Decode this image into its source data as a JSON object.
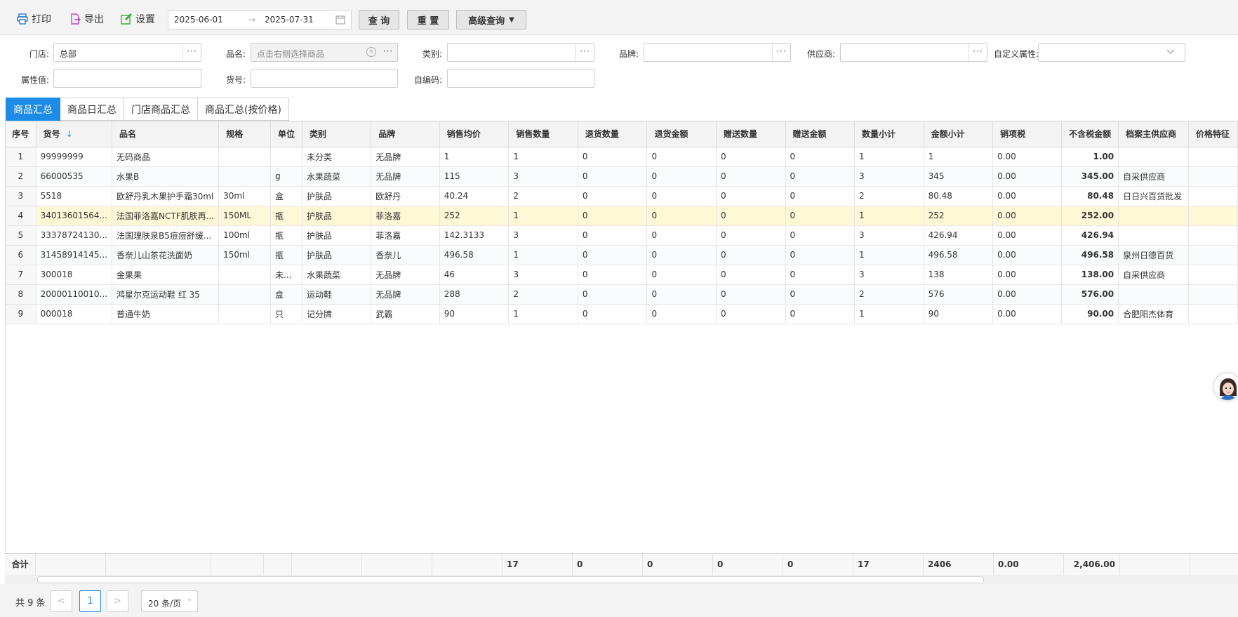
{
  "toolbar": {
    "print_label": "打印",
    "export_label": "导出",
    "settings_label": "设置",
    "date_start": "2025-06-01",
    "date_sep": "→",
    "date_end": "2025-07-31",
    "query_label": "查 询",
    "reset_label": "重 置",
    "advanced_label": "高级查询"
  },
  "filters": {
    "store_label": "门店:",
    "store_value": "总部",
    "product_label": "品名:",
    "product_placeholder": "点击右侧选择商品",
    "category_label": "类别:",
    "brand_label": "品牌:",
    "supplier_label": "供应商:",
    "custom_attr_label": "自定义属性:",
    "attr_value_label": "属性值:",
    "sku_label": "货号:",
    "selfcode_label": "自编码:",
    "dots": "···"
  },
  "tabs": [
    "商品汇总",
    "商品日汇总",
    "门店商品汇总",
    "商品汇总(按价格)"
  ],
  "table": {
    "headers": [
      "序号",
      "货号",
      "品名",
      "规格",
      "单位",
      "类别",
      "品牌",
      "销售均价",
      "销售数量",
      "退货数量",
      "退货金额",
      "赠送数量",
      "赠送金额",
      "数量小计",
      "金额小计",
      "销项税",
      "不含税金额",
      "档案主供应商",
      "价格特征"
    ],
    "sort_icon": "↓",
    "rows": [
      [
        "1",
        "99999999",
        "无码商品",
        "",
        "",
        "未分类",
        "无品牌",
        "1",
        "1",
        "0",
        "0",
        "0",
        "0",
        "1",
        "1",
        "0.00",
        "1.00",
        "",
        ""
      ],
      [
        "2",
        "66000535",
        "水果B",
        "",
        "g",
        "水果蔬菜",
        "无品牌",
        "115",
        "3",
        "0",
        "0",
        "0",
        "0",
        "3",
        "345",
        "0.00",
        "345.00",
        "自采供应商",
        ""
      ],
      [
        "3",
        "5518",
        "欧舒丹乳木果护手霜30ml",
        "30ml",
        "盒",
        "护肤品",
        "欧舒丹",
        "40.24",
        "2",
        "0",
        "0",
        "0",
        "0",
        "2",
        "80.48",
        "0.00",
        "80.48",
        "日日兴百货批发",
        ""
      ],
      [
        "4",
        "34013601564...",
        "法国菲洛嘉NCTF肌肤再...",
        "150ML",
        "瓶",
        "护肤品",
        "菲洛嘉",
        "252",
        "1",
        "0",
        "0",
        "0",
        "0",
        "1",
        "252",
        "0.00",
        "252.00",
        "",
        ""
      ],
      [
        "5",
        "33378724130...",
        "法国理肤泉B5痘痘舒缓...",
        "100ml",
        "瓶",
        "护肤品",
        "菲洛嘉",
        "142.3133",
        "3",
        "0",
        "0",
        "0",
        "0",
        "3",
        "426.94",
        "0.00",
        "426.94",
        "",
        ""
      ],
      [
        "6",
        "31458914145...",
        "香奈儿山茶花洗面奶",
        "150ml",
        "瓶",
        "护肤品",
        "香奈儿",
        "496.58",
        "1",
        "0",
        "0",
        "0",
        "0",
        "1",
        "496.58",
        "0.00",
        "496.58",
        "泉州日德百货",
        ""
      ],
      [
        "7",
        "300018",
        "金果果",
        "",
        "未...",
        "水果蔬菜",
        "无品牌",
        "46",
        "3",
        "0",
        "0",
        "0",
        "0",
        "3",
        "138",
        "0.00",
        "138.00",
        "自采供应商",
        ""
      ],
      [
        "8",
        "20000110010...",
        "鸿星尔克运动鞋 红 35",
        "",
        "盒",
        "运动鞋",
        "无品牌",
        "288",
        "2",
        "0",
        "0",
        "0",
        "0",
        "2",
        "576",
        "0.00",
        "576.00",
        "",
        ""
      ],
      [
        "9",
        "000018",
        "普通牛奶",
        "",
        "只",
        "记分牌",
        "武霸",
        "90",
        "1",
        "0",
        "0",
        "0",
        "0",
        "1",
        "90",
        "0.00",
        "90.00",
        "合肥阳杰体育",
        ""
      ]
    ],
    "selected_row": 3,
    "totals": {
      "label": "合计",
      "sales_qty": "17",
      "return_qty": "0",
      "return_amt": "0",
      "gift_qty": "0",
      "gift_amt": "0",
      "qty_subtotal": "17",
      "amt_subtotal": "2406",
      "tax": "0.00",
      "net_amt": "2,406.00"
    }
  },
  "pager": {
    "total_text": "共 9 条",
    "prev": "<",
    "current": "1",
    "next": ">",
    "page_size": "20 条/页"
  },
  "colors": {
    "accent": "#1e8be6",
    "selected_row": "#fdf9d7"
  }
}
